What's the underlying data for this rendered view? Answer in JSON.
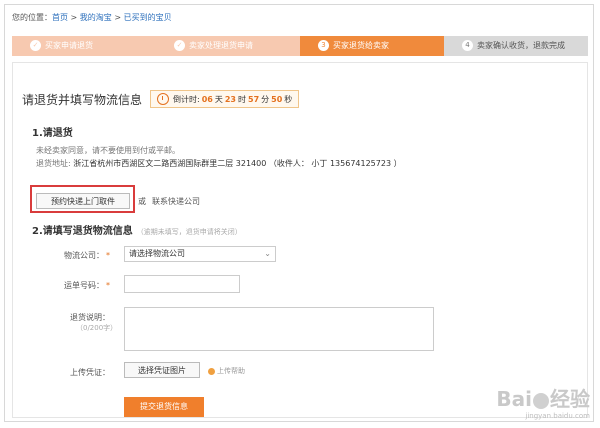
{
  "breadcrumb": {
    "prefix": "您的位置：",
    "items": [
      "首页",
      "我的淘宝",
      "已买到的宝贝"
    ],
    "separator": " > "
  },
  "steps": [
    {
      "label": "买家申请退货",
      "state": "done"
    },
    {
      "label": "卖家处理退货申请",
      "state": "done"
    },
    {
      "num": "3",
      "label": "买家退货给卖家",
      "state": "active"
    },
    {
      "num": "4",
      "label": "卖家确认收货，退款完成",
      "state": "todo"
    }
  ],
  "header": {
    "title": "请退货并填写物流信息",
    "countdown_label": "倒计时:",
    "days": "06",
    "day_unit": "天",
    "hours": "23",
    "hour_unit": "时",
    "minutes": "57",
    "minute_unit": "分",
    "seconds": "50",
    "second_unit": "秒"
  },
  "section1": {
    "title": "1.请退货",
    "note": "未经卖家同意，请不要使用到付或平邮。",
    "address_label": "退货地址:",
    "address_value": "浙江省杭州市西湖区文二路西湖国际群里二层 321400 （收件人： 小丁  135674125723 ）",
    "pickup_button": "预约快递上门取件",
    "or": "或",
    "contact": "联系快递公司"
  },
  "section2": {
    "title": "2.请填写退货物流信息",
    "hint": "（逾期未填写，退货申请将关闭）",
    "company_label": "物流公司：",
    "company_placeholder": "请选择物流公司",
    "tracking_label": "运单号码：",
    "desc_label": "退货说明：",
    "desc_hint": "（0/200字）",
    "upload_label": "上传凭证：",
    "upload_button": "选择凭证图片",
    "upload_help": "上传帮助",
    "submit": "提交退货信息"
  },
  "watermark": {
    "logo_text": "Bai",
    "logo_text2": "经验",
    "url": "jingyan.baidu.com"
  },
  "colors": {
    "accent": "#f07f2c",
    "step_done": "#f7c9b0",
    "step_todo": "#d9d9d9",
    "highlight_box": "#d93c3c"
  }
}
